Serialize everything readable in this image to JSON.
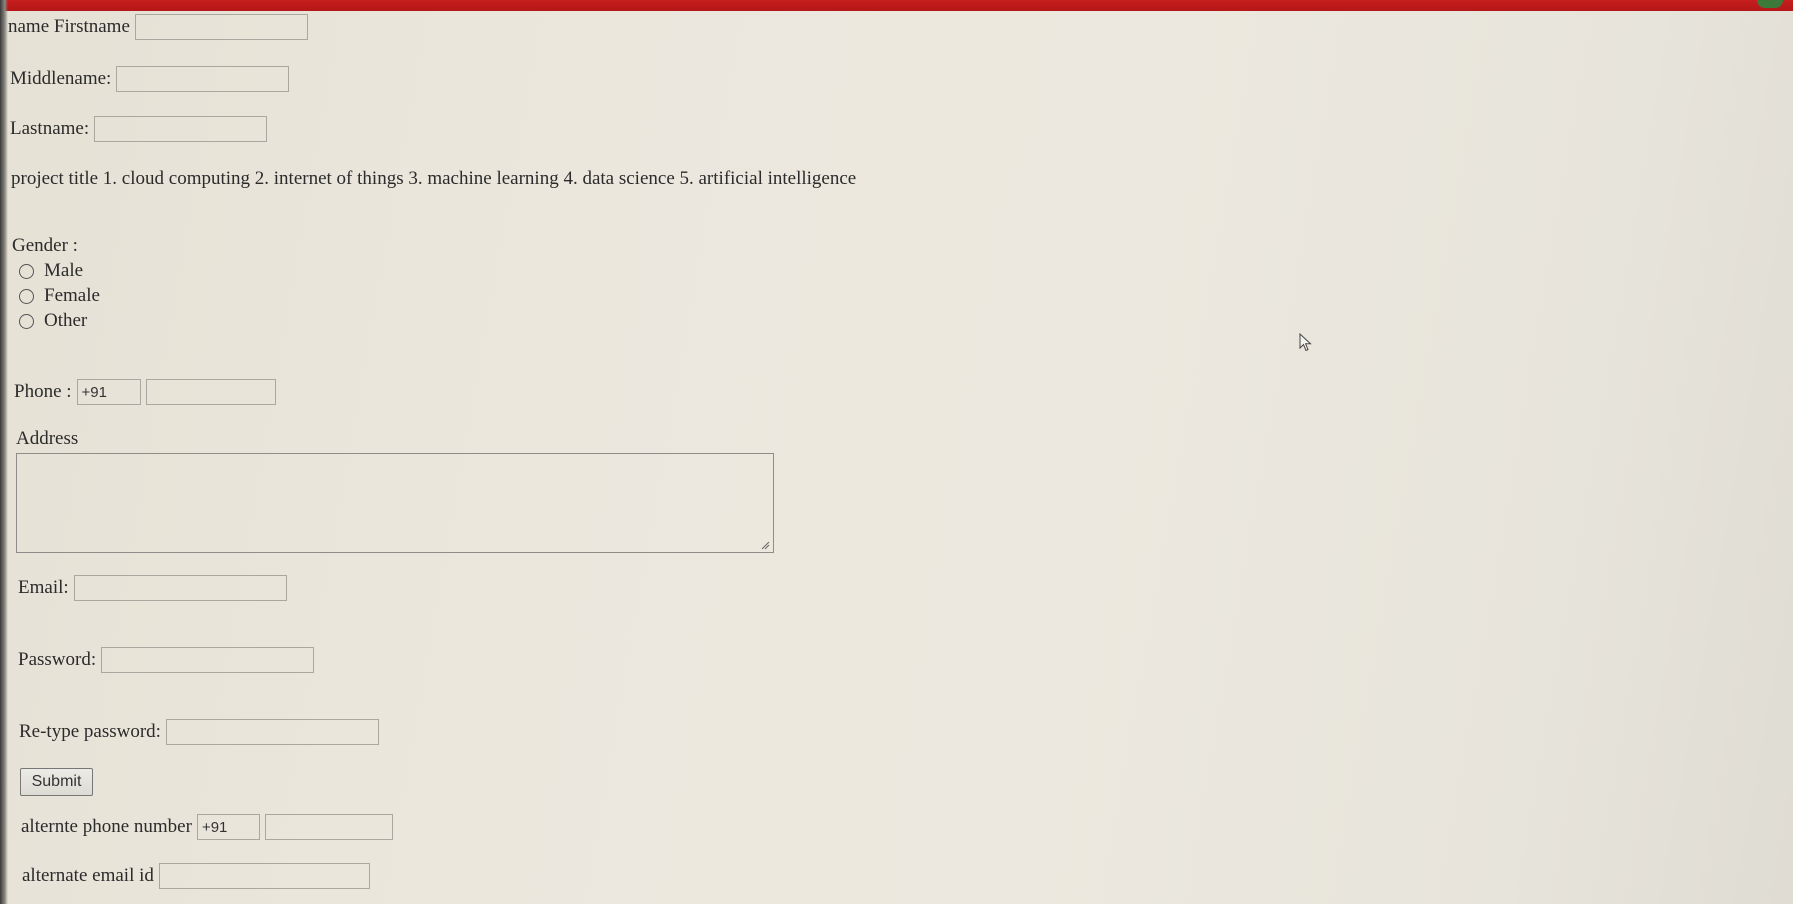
{
  "form": {
    "firstname_label": "name Firstname",
    "middlename_label": "Middlename:",
    "lastname_label": "Lastname:",
    "project_title": "project title 1. cloud computing 2. internet of things 3. machine learning 4. data science 5. artificial intelligence",
    "gender_label": "Gender :",
    "gender_options": [
      "Male",
      "Female",
      "Other"
    ],
    "phone_label": "Phone :",
    "phone_code": "+91",
    "address_label": "Address",
    "email_label": "Email:",
    "password_label": "Password:",
    "retype_label": "Re-type password:",
    "submit_label": "Submit",
    "alt_phone_label": "alternte phone number",
    "alt_phone_code": "+91",
    "alt_email_label": "alternate email id"
  },
  "colors": {
    "top_bar": "#c81e1e",
    "background": "#ebe7dd",
    "input_border": "#a9a7a0"
  },
  "icons": {
    "cursor": "mouse-pointer-icon",
    "resize": "resize-grip-icon"
  }
}
